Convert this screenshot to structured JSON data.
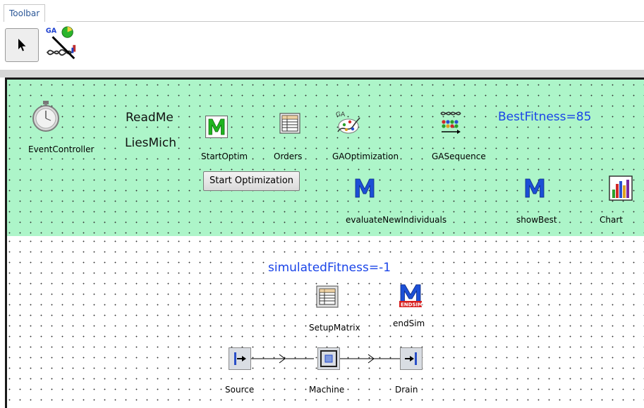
{
  "tabs": {
    "toolbar": "Toolbar"
  },
  "toolbar_buttons": [
    {
      "icon": "pointer-arrow-icon"
    },
    {
      "icon": "ga-wizard-icon",
      "badge": "GA"
    }
  ],
  "frame": {
    "event_controller": "EventController",
    "readme": "ReadMe",
    "liesmich": "LiesMich",
    "start_optim": "StartOptim",
    "orders": "Orders",
    "ga_optimization": "GAOptimization",
    "ga_optimization_badge": "GA",
    "ga_sequence": "GASequence",
    "best_fitness": "BestFitness=85",
    "start_button": "Start Optimization",
    "evaluate": "evaluateNewIndividuals",
    "show_best": "showBest",
    "chart": "Chart",
    "simulated_fitness": "simulatedFitness=-1",
    "setup_matrix": "SetupMatrix",
    "end_sim": "endSim",
    "end_sim_badge": "ENDSIM",
    "source": "Source",
    "machine": "Machine",
    "drain": "Drain"
  },
  "colors": {
    "tint": "#adf5c9",
    "blue_text": "#1a44e8",
    "method_green": "#1fb51f",
    "method_blue": "#1c4fd6"
  }
}
